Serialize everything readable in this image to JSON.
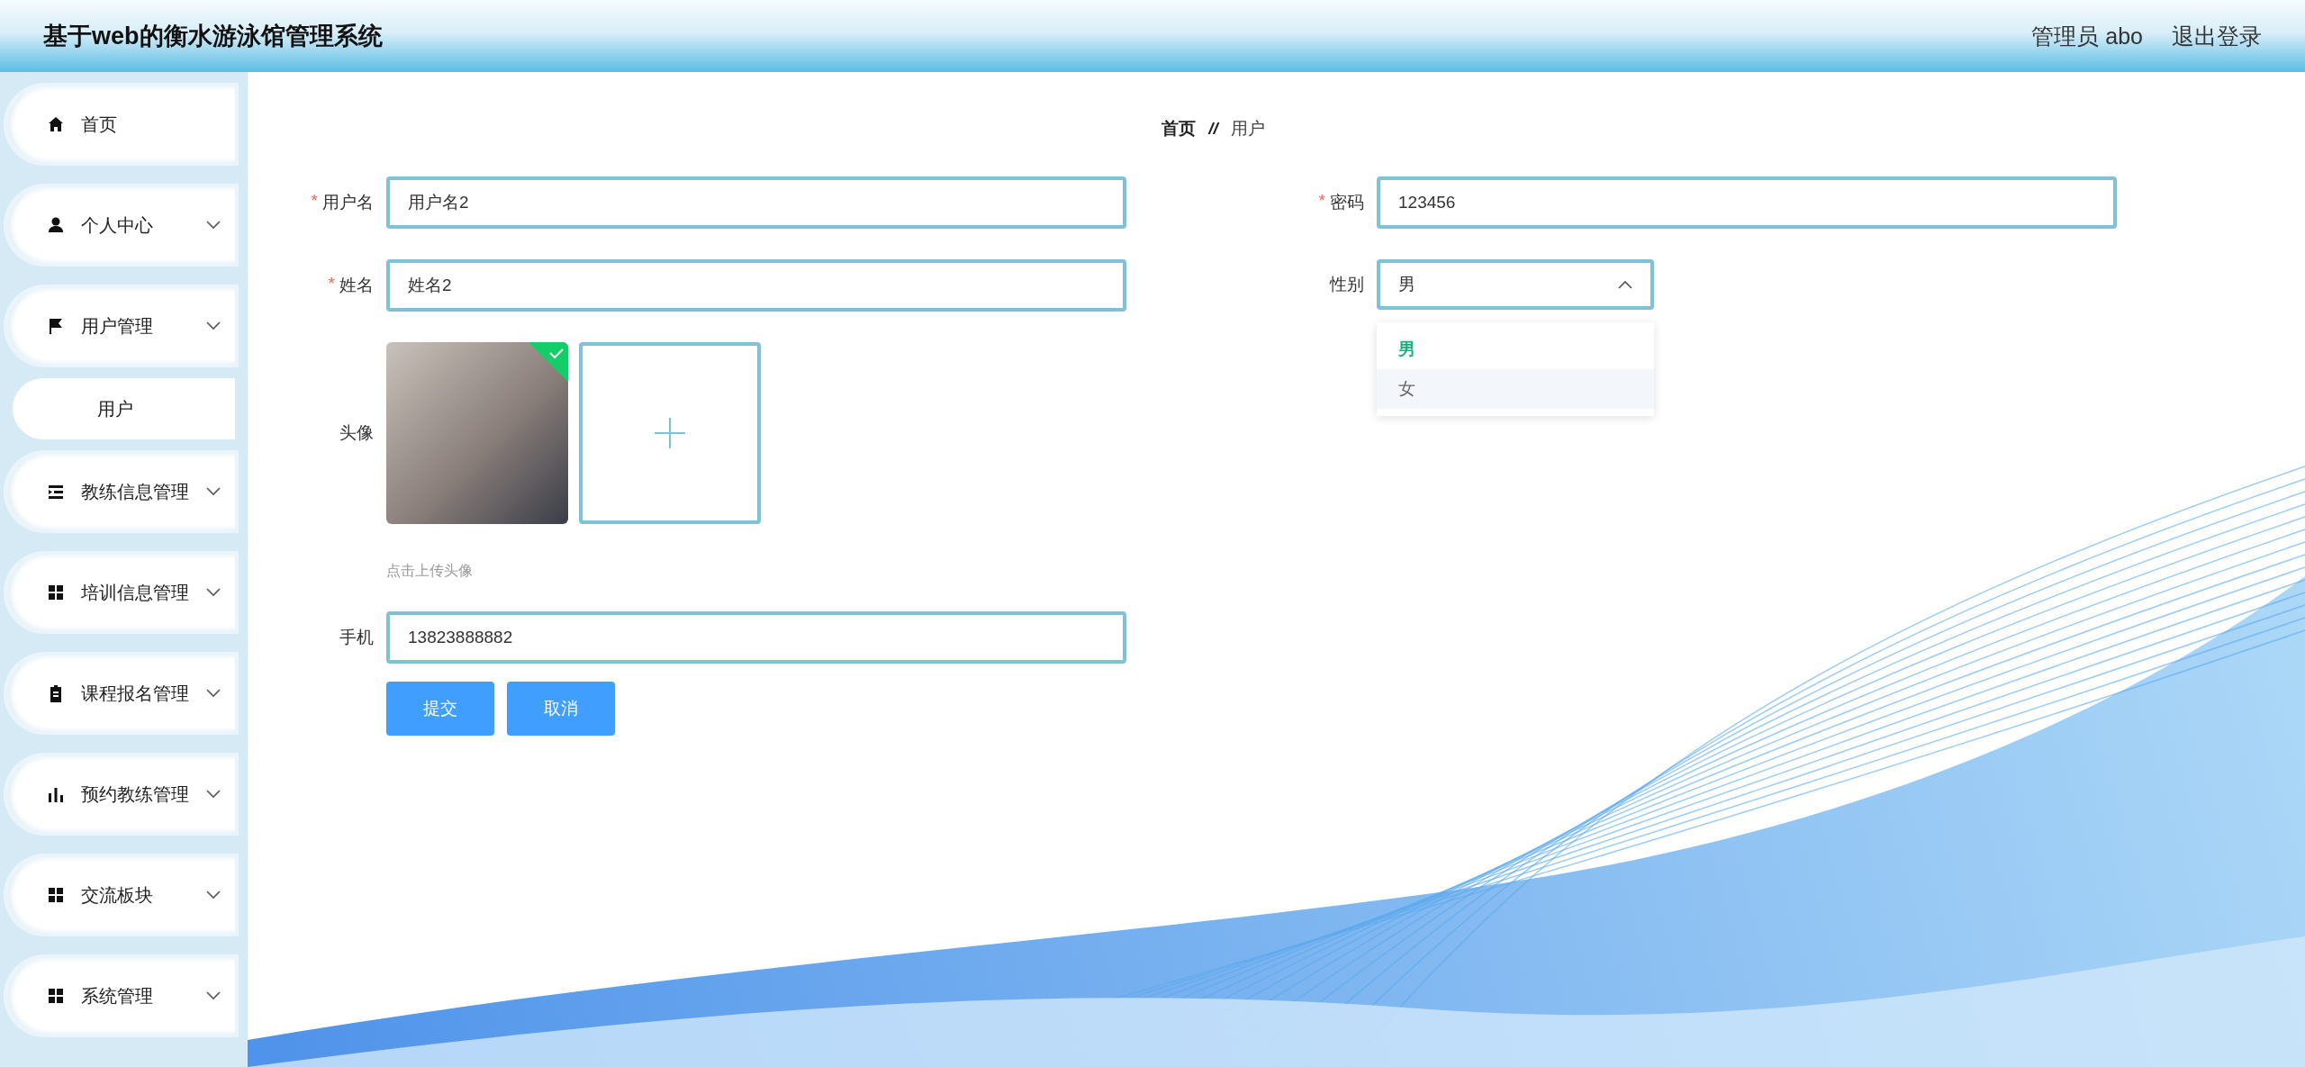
{
  "header": {
    "title": "基于web的衡水游泳馆管理系统",
    "user": "管理员 abo",
    "logout": "退出登录"
  },
  "sidebar": {
    "items": [
      {
        "label": "首页",
        "has_arrow": false
      },
      {
        "label": "个人中心",
        "has_arrow": true
      },
      {
        "label": "用户管理",
        "has_arrow": true,
        "children": [
          {
            "label": "用户"
          }
        ]
      },
      {
        "label": "教练信息管理",
        "has_arrow": true
      },
      {
        "label": "培训信息管理",
        "has_arrow": true
      },
      {
        "label": "课程报名管理",
        "has_arrow": true
      },
      {
        "label": "预约教练管理",
        "has_arrow": true
      },
      {
        "label": "交流板块",
        "has_arrow": true
      },
      {
        "label": "系统管理",
        "has_arrow": true
      }
    ]
  },
  "breadcrumb": {
    "home": "首页",
    "separator": "//",
    "current": "用户"
  },
  "form": {
    "username": {
      "label": "用户名",
      "mark": "*",
      "value": "用户名2"
    },
    "password": {
      "label": "密码",
      "mark": "*",
      "value": "123456"
    },
    "name": {
      "label": "姓名",
      "mark": "*",
      "value": "姓名2"
    },
    "gender": {
      "label": "性别",
      "value": "男",
      "expanded": true,
      "options": [
        {
          "label": "男",
          "selected": true,
          "hovered": false
        },
        {
          "label": "女",
          "selected": false,
          "hovered": true
        }
      ]
    },
    "avatar": {
      "label": "头像",
      "uploaded": true,
      "hint": "点击上传头像"
    },
    "phone": {
      "label": "手机",
      "value": "13823888882"
    },
    "buttons": [
      "提交",
      "取消"
    ]
  }
}
